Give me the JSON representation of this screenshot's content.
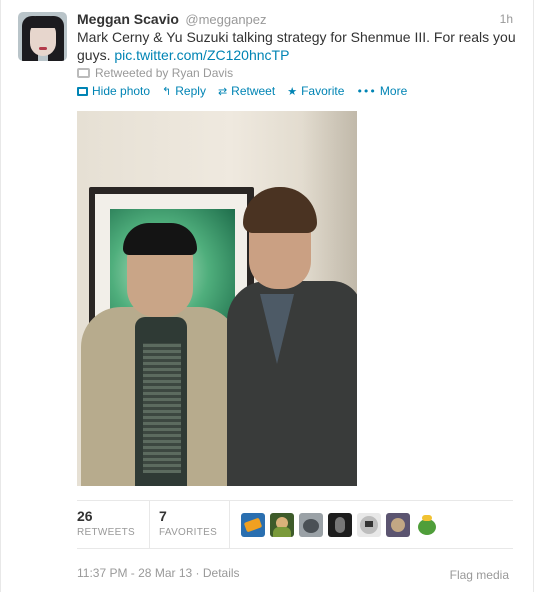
{
  "tweet": {
    "fullname": "Meggan Scavio",
    "username": "@megganpez",
    "time": "1h",
    "text": "Mark Cerny & Yu Suzuki talking strategy for  Shenmue III. For reals you guys.",
    "link": "pic.twitter.com/ZC120hncTP",
    "retweeted_by": "Retweeted by Ryan Davis"
  },
  "actions": {
    "hide_photo": "Hide photo",
    "reply": "Reply",
    "retweet": "Retweet",
    "favorite": "Favorite",
    "more": "More"
  },
  "stats": {
    "retweets_count": "26",
    "retweets_label": "RETWEETS",
    "favorites_count": "7",
    "favorites_label": "FAVORITES"
  },
  "footer": {
    "timestamp": "11:37 PM - 28 Mar 13",
    "separator": "·",
    "details": "Details",
    "flag": "Flag media"
  },
  "colors": {
    "link": "#0084b4",
    "muted": "#999999",
    "text": "#333333"
  },
  "icons": {
    "hide_photo": "photo-icon",
    "reply": "reply-icon",
    "retweet": "retweet-icon",
    "favorite": "star-icon",
    "more": "dots-icon"
  }
}
